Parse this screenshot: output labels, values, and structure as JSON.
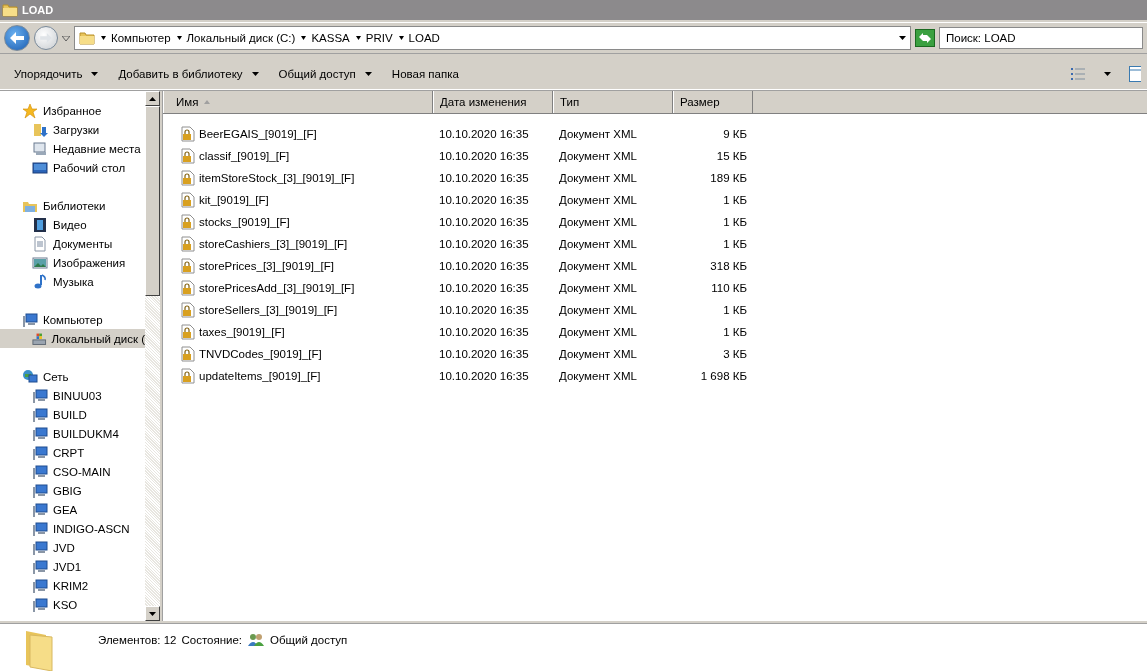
{
  "window": {
    "title": "LOAD"
  },
  "address": {
    "crumbs": [
      "Компьютер",
      "Локальный диск (C:)",
      "KASSA",
      "PRIV",
      "LOAD"
    ]
  },
  "search": {
    "placeholder": "Поиск: LOAD"
  },
  "toolbar": [
    {
      "label": "Упорядочить",
      "dropdown": true
    },
    {
      "label": "Добавить в библиотеку",
      "dropdown": true
    },
    {
      "label": "Общий доступ",
      "dropdown": true
    },
    {
      "label": "Новая папка",
      "dropdown": false
    }
  ],
  "sidebar": {
    "sections": [
      {
        "label": "Избранное",
        "kind": "star",
        "children": [
          {
            "label": "Загрузки",
            "kind": "downloads",
            "selected": false
          },
          {
            "label": "Недавние места",
            "kind": "recent",
            "selected": false
          },
          {
            "label": "Рабочий стол",
            "kind": "desktop",
            "selected": false
          }
        ]
      },
      {
        "label": "Библиотеки",
        "kind": "library",
        "children": [
          {
            "label": "Видео",
            "kind": "video",
            "selected": false
          },
          {
            "label": "Документы",
            "kind": "document",
            "selected": false
          },
          {
            "label": "Изображения",
            "kind": "image",
            "selected": false
          },
          {
            "label": "Музыка",
            "kind": "music",
            "selected": false
          }
        ]
      },
      {
        "label": "Компьютер",
        "kind": "computer",
        "children": [
          {
            "label": "Локальный диск (",
            "kind": "drive",
            "selected": true
          }
        ]
      },
      {
        "label": "Сеть",
        "kind": "network",
        "children": [
          {
            "label": "BINUU03",
            "kind": "pc",
            "selected": false
          },
          {
            "label": "BUILD",
            "kind": "pc",
            "selected": false
          },
          {
            "label": "BUILDUKM4",
            "kind": "pc",
            "selected": false
          },
          {
            "label": "CRPT",
            "kind": "pc",
            "selected": false
          },
          {
            "label": "CSO-MAIN",
            "kind": "pc",
            "selected": false
          },
          {
            "label": "GBIG",
            "kind": "pc",
            "selected": false
          },
          {
            "label": "GEA",
            "kind": "pc",
            "selected": false
          },
          {
            "label": "INDIGO-ASCN",
            "kind": "pc",
            "selected": false
          },
          {
            "label": "JVD",
            "kind": "pc",
            "selected": false
          },
          {
            "label": "JVD1",
            "kind": "pc",
            "selected": false
          },
          {
            "label": "KRIM2",
            "kind": "pc",
            "selected": false
          },
          {
            "label": "KSO",
            "kind": "pc",
            "selected": false
          }
        ]
      }
    ]
  },
  "table": {
    "columns": [
      "Имя",
      "Дата изменения",
      "Тип",
      "Размер"
    ],
    "rows": [
      [
        "BeerEGAIS_[9019]_[F]",
        "10.10.2020 16:35",
        "Документ XML",
        "9 КБ"
      ],
      [
        "classif_[9019]_[F]",
        "10.10.2020 16:35",
        "Документ XML",
        "15 КБ"
      ],
      [
        "itemStoreStock_[3]_[9019]_[F]",
        "10.10.2020 16:35",
        "Документ XML",
        "189 КБ"
      ],
      [
        "kit_[9019]_[F]",
        "10.10.2020 16:35",
        "Документ XML",
        "1 КБ"
      ],
      [
        "stocks_[9019]_[F]",
        "10.10.2020 16:35",
        "Документ XML",
        "1 КБ"
      ],
      [
        "storeCashiers_[3]_[9019]_[F]",
        "10.10.2020 16:35",
        "Документ XML",
        "1 КБ"
      ],
      [
        "storePrices_[3]_[9019]_[F]",
        "10.10.2020 16:35",
        "Документ XML",
        "318 КБ"
      ],
      [
        "storePricesAdd_[3]_[9019]_[F]",
        "10.10.2020 16:35",
        "Документ XML",
        "110 КБ"
      ],
      [
        "storeSellers_[3]_[9019]_[F]",
        "10.10.2020 16:35",
        "Документ XML",
        "1 КБ"
      ],
      [
        "taxes_[9019]_[F]",
        "10.10.2020 16:35",
        "Документ XML",
        "1 КБ"
      ],
      [
        "TNVDCodes_[9019]_[F]",
        "10.10.2020 16:35",
        "Документ XML",
        "3 КБ"
      ],
      [
        "updateItems_[9019]_[F]",
        "10.10.2020 16:35",
        "Документ XML",
        "1 698 КБ"
      ]
    ]
  },
  "details": {
    "count": "Элементов: 12",
    "state_label": "Состояние:",
    "state": "Общий доступ"
  }
}
